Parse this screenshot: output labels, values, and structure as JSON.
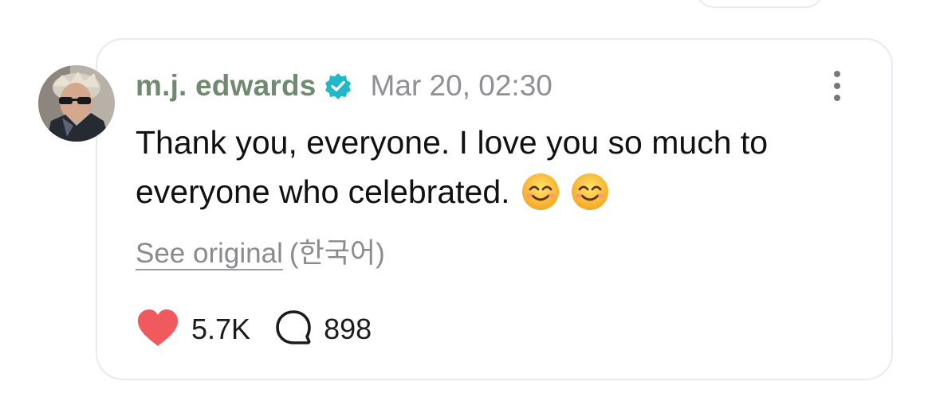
{
  "post": {
    "author": "m.j. edwards",
    "verified": true,
    "timestamp": "Mar 20, 02:30",
    "text": "Thank you, everyone. I love you so much to everyone who celebrated.",
    "emojis": [
      "smiling-face-with-smiling-eyes",
      "smiling-face-with-smiling-eyes"
    ],
    "translation": {
      "see_original_label": "See original",
      "language": "(한국어)"
    },
    "stats": {
      "likes": "5.7K",
      "comments": "898"
    }
  },
  "icons": {
    "like": "heart-icon",
    "comment": "speech-bubble-icon",
    "more": "vertical-ellipsis-icon",
    "verified": "verified-badge-icon"
  },
  "colors": {
    "author": "#6f8a6f",
    "verified_badge": "#21b8c9",
    "heart": "#f05a5e",
    "muted_text": "#8f8f95",
    "card_border": "#ebe8f0"
  }
}
